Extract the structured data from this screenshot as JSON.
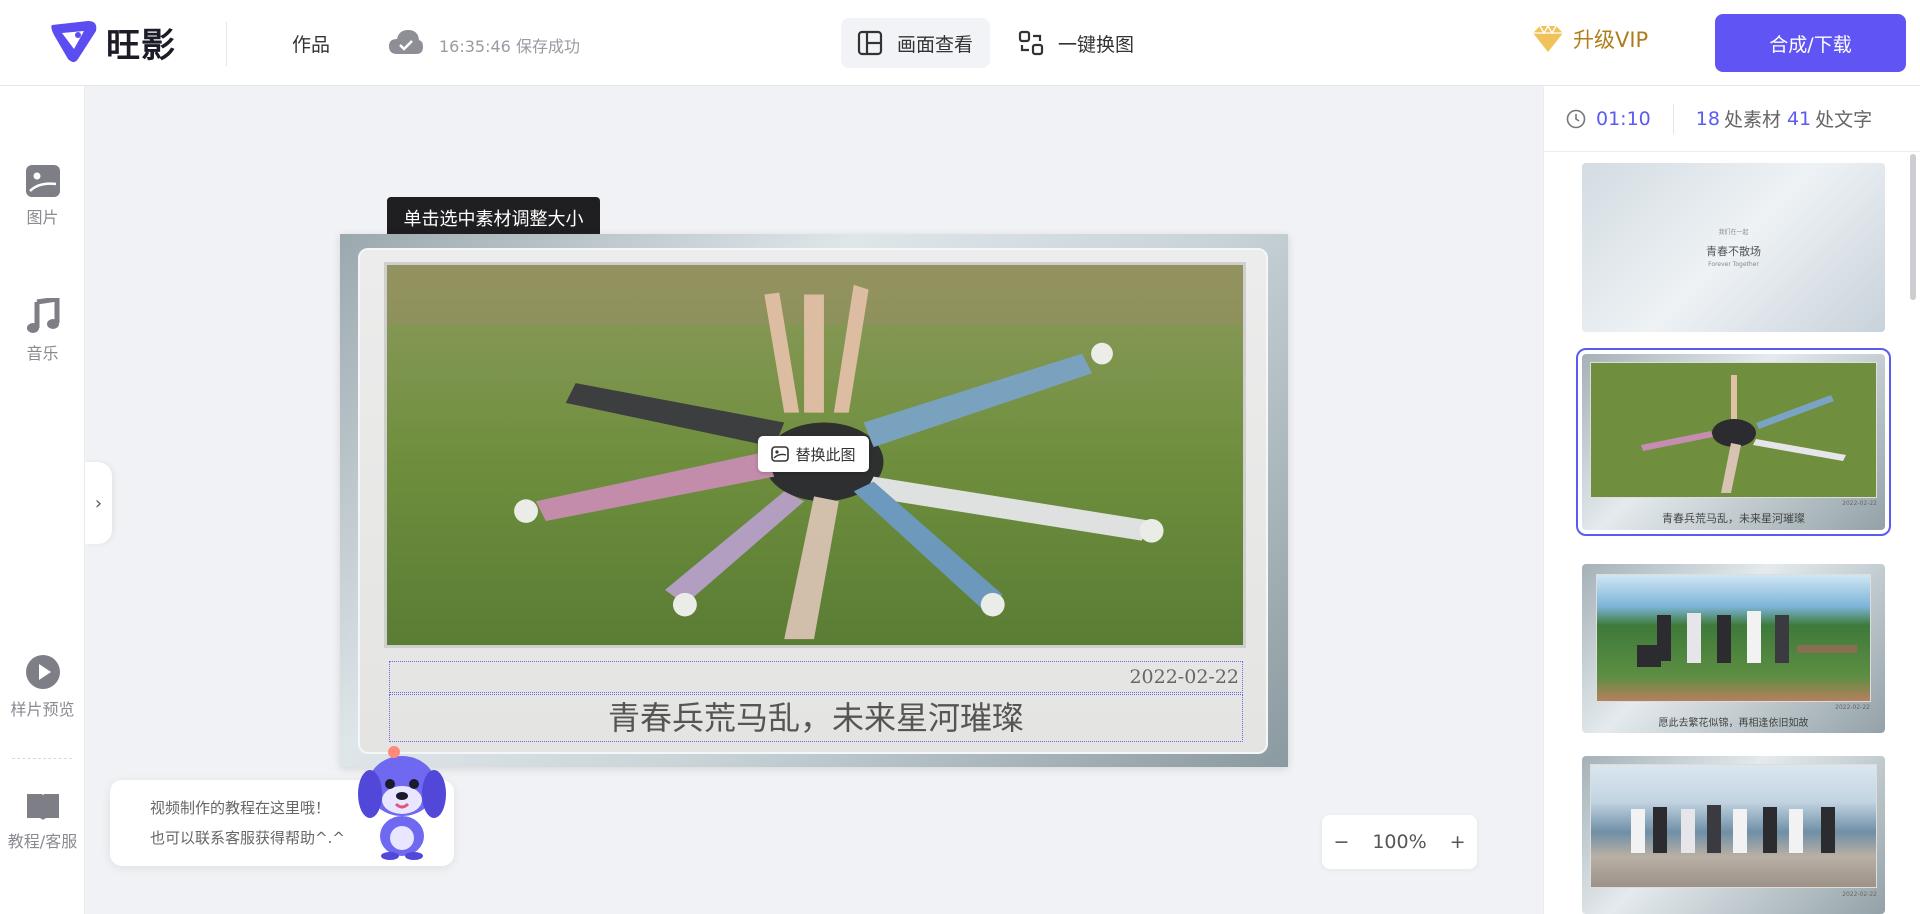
{
  "header": {
    "brand_name": "旺影",
    "nav_works": "作品",
    "save_status": "16:35:46 保存成功",
    "view_label": "画面查看",
    "swap_label": "一键换图",
    "vip_label": "升级VIP",
    "merge_label": "合成/下载",
    "accent_color": "#6154f5"
  },
  "sidebar": {
    "items": [
      {
        "label": "图片",
        "icon": "image-icon"
      },
      {
        "label": "音乐",
        "icon": "music-icon"
      },
      {
        "label": "样片预览",
        "icon": "play-icon"
      },
      {
        "label": "教程/客服",
        "icon": "book-icon"
      }
    ],
    "collapse_glyph": "›"
  },
  "canvas": {
    "tooltip": "单击选中素材调整大小",
    "replace_label": "替换此图",
    "date_text": "2022-02-22",
    "caption_text": "青春兵荒马乱，未来星河璀璨"
  },
  "help": {
    "line1": "视频制作的教程在这里哦！",
    "line2": "也可以联系客服获得帮助^.^"
  },
  "zoom": {
    "minus": "−",
    "level": "100%",
    "plus": "+"
  },
  "right_panel": {
    "duration": "01:10",
    "material_count": "18",
    "material_label": "处素材",
    "text_count": "41",
    "text_label": "处文字",
    "thumbs": [
      {
        "title": "青春不散场",
        "kicker": "我们在一起",
        "sub": "Forever Together"
      },
      {
        "caption": "青春兵荒马乱，未来星河璀璨",
        "date": "2022-02-22"
      },
      {
        "caption": "愿此去繁花似锦，再相逢依旧如故",
        "date": "2022-02-22"
      },
      {
        "caption": "",
        "date": "2022-02-22"
      }
    ]
  }
}
